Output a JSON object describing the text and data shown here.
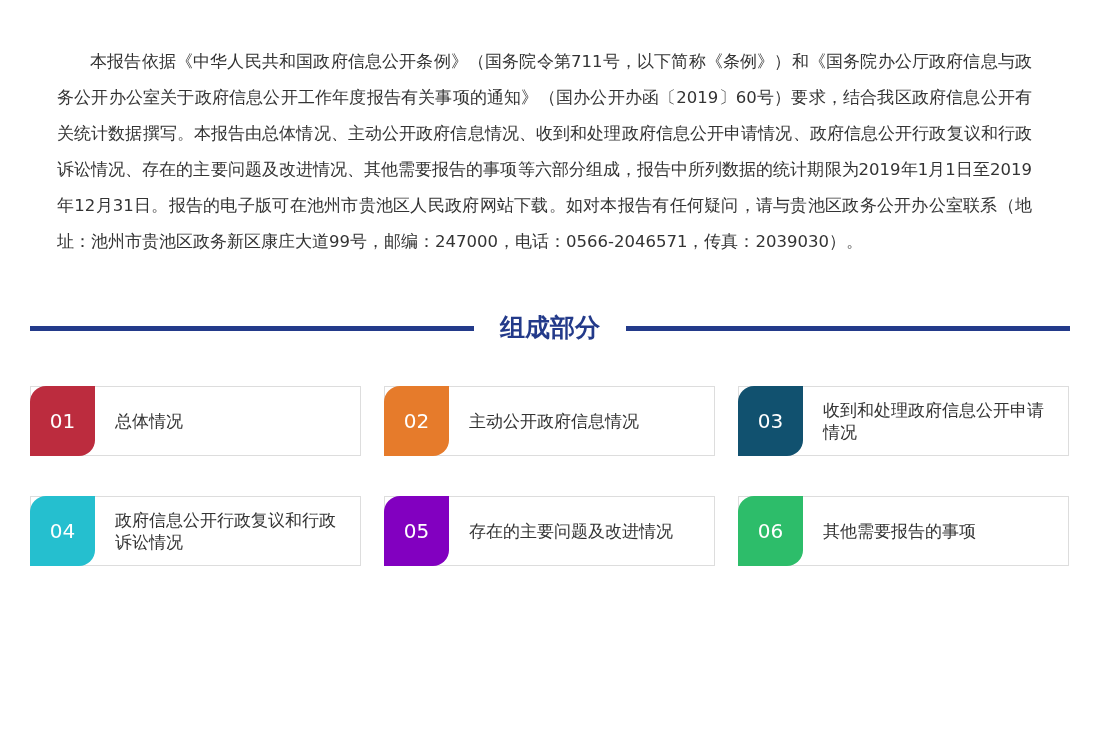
{
  "intro": "本报告依据《中华人民共和国政府信息公开条例》（国务院令第711号，以下简称《条例》）和《国务院办公厅政府信息与政务公开办公室关于政府信息公开工作年度报告有关事项的通知》（国办公开办函〔2019〕60号）要求，结合我区政府信息公开有关统计数据撰写。本报告由总体情况、主动公开政府信息情况、收到和处理政府信息公开申请情况、政府信息公开行政复议和行政诉讼情况、存在的主要问题及改进情况、其他需要报告的事项等六部分组成，报告中所列数据的统计期限为2019年1月1日至2019年12月31日。报告的电子版可在池州市贵池区人民政府网站下载。如对本报告有任何疑问，请与贵池区政务公开办公室联系（地址：池州市贵池区政务新区康庄大道99号，邮编：247000，电话：0566-2046571，传真：2039030）。",
  "section_title": "组成部分",
  "parts": [
    {
      "number": "01",
      "label": "总体情况",
      "color": "#bc2c3e"
    },
    {
      "number": "02",
      "label": "主动公开政府信息情况",
      "color": "#e67b2b"
    },
    {
      "number": "03",
      "label": "收到和处理政府信息公开申请情况",
      "color": "#11516f"
    },
    {
      "number": "04",
      "label": "政府信息公开行政复议和行政诉讼情况",
      "color": "#25bfcf"
    },
    {
      "number": "05",
      "label": "存在的主要问题及改进情况",
      "color": "#8200c0"
    },
    {
      "number": "06",
      "label": "其他需要报告的事项",
      "color": "#2dbd6a"
    }
  ]
}
